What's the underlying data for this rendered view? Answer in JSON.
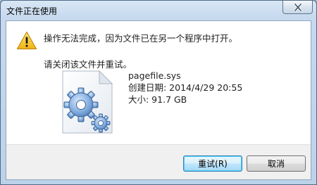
{
  "window": {
    "title": "文件正在使用",
    "close_icon": "close-icon"
  },
  "message": {
    "icon": "warning-icon",
    "line1": "操作无法完成，因为文件已在另一个程序中打开。",
    "line2": "请关闭该文件并重试。"
  },
  "file": {
    "icon": "system-file-gear-icon",
    "name": "pagefile.sys",
    "created": "创建日期: 2014/4/29 20:55",
    "size": "大小: 91.7 GB"
  },
  "buttons": {
    "retry_label": "重试(R)",
    "cancel_label": "取消"
  },
  "colors": {
    "warning_yellow": "#f6c31b",
    "default_button_border": "#3c7fb1",
    "gear_blue": "#6e9ed6"
  }
}
